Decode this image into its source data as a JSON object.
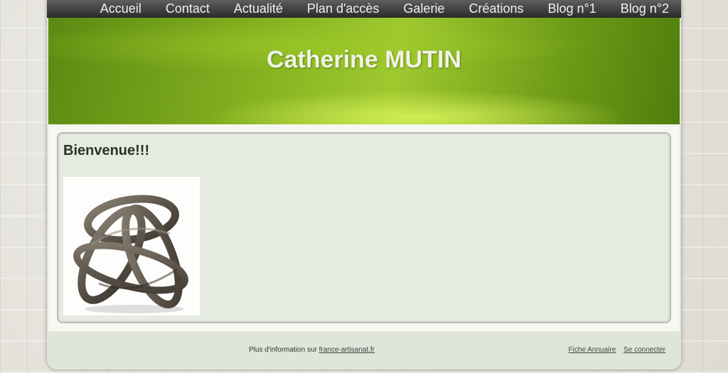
{
  "nav": {
    "items": [
      {
        "label": "Accueil"
      },
      {
        "label": "Contact"
      },
      {
        "label": "Actualité"
      },
      {
        "label": "Plan d'accès"
      },
      {
        "label": "Galerie"
      },
      {
        "label": "Créations"
      },
      {
        "label": "Blog n°1"
      },
      {
        "label": "Blog n°2"
      }
    ]
  },
  "header": {
    "title": "Catherine MUTIN"
  },
  "main": {
    "heading": "Bienvenue!!!"
  },
  "footer": {
    "info_prefix": "Plus d'information sur",
    "info_link": "france-artisanat.fr",
    "fiche_label": "Fiche Annuaire",
    "login_label": "Se connecter"
  },
  "colors": {
    "banner_green": "#86b321",
    "nav_bg": "#3a3a3a",
    "content_bg": "#e6ebe1"
  }
}
